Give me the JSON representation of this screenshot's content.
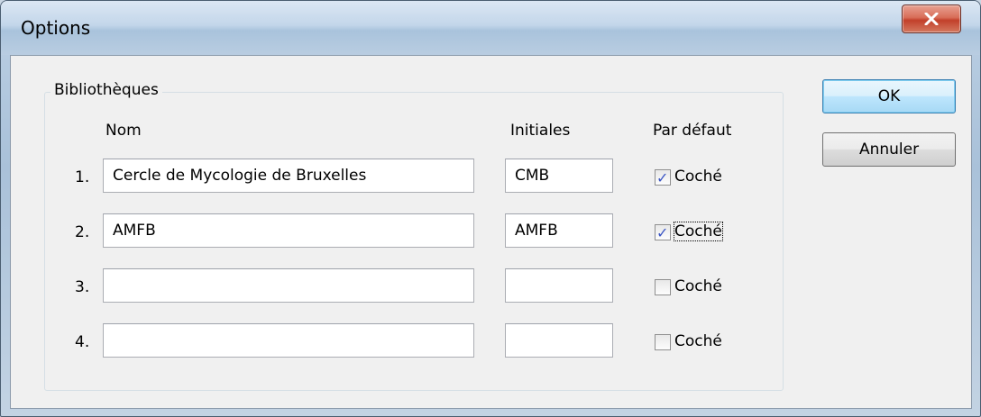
{
  "window": {
    "title": "Options"
  },
  "group": {
    "label": "Bibliothèques",
    "headers": {
      "name": "Nom",
      "initials": "Initiales",
      "default": "Par défaut"
    },
    "rows": [
      {
        "num": "1.",
        "name": "Cercle de Mycologie de Bruxelles",
        "initials": "CMB",
        "checked": true,
        "checkbox_label": "Coché"
      },
      {
        "num": "2.",
        "name": "AMFB",
        "initials": "AMFB",
        "checked": true,
        "checkbox_label": "Coché"
      },
      {
        "num": "3.",
        "name": "",
        "initials": "",
        "checked": false,
        "checkbox_label": "Coché"
      },
      {
        "num": "4.",
        "name": "",
        "initials": "",
        "checked": false,
        "checkbox_label": "Coché"
      }
    ]
  },
  "buttons": {
    "ok": "OK",
    "cancel": "Annuler"
  },
  "icons": {
    "close": "close-icon",
    "check": "checkmark-icon"
  },
  "colors": {
    "close_button": "#c2402a",
    "check": "#3a55c4",
    "default_button_border": "#3c7fb1"
  }
}
